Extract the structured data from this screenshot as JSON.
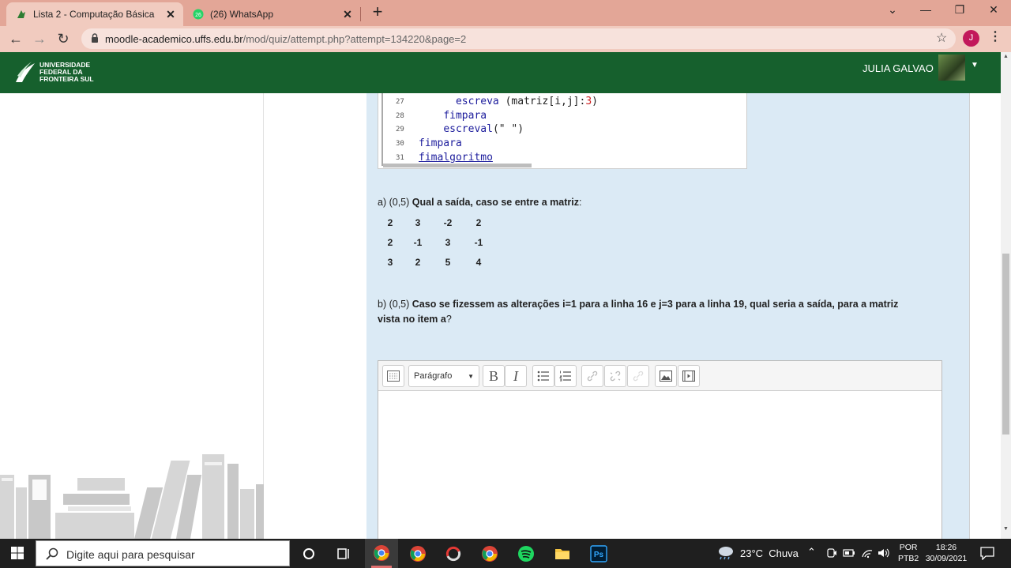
{
  "browser": {
    "tabs": [
      {
        "label": "Lista 2 - Computação Básica",
        "active": true
      },
      {
        "label": "(26) WhatsApp",
        "active": false,
        "badge": "26"
      }
    ],
    "new_tab": "+",
    "close_glyph": "✕",
    "window": {
      "chevron": "⌄",
      "minimize": "—",
      "restore": "❐",
      "close": "✕"
    },
    "url_host": "moodle-academico.uffs.edu.br",
    "url_path": "/mod/quiz/attempt.php?attempt=134220&page=2",
    "profile_initial": "J"
  },
  "moodle": {
    "logo_lines": [
      "UNIVERSIDADE",
      "FEDERAL DA",
      "FRONTEIRA SUL"
    ],
    "user_name": "JULIA GALVAO"
  },
  "code": {
    "lines": [
      {
        "n": "27",
        "indent": "      ",
        "kw": "escreva",
        "rest": " (matriz[i,j]:",
        "num": "3",
        "end": ")"
      },
      {
        "n": "28",
        "indent": "    ",
        "kw": "fimpara",
        "rest": "",
        "num": "",
        "end": ""
      },
      {
        "n": "29",
        "indent": "    ",
        "kw": "escreval",
        "rest": "(\" \")",
        "num": "",
        "end": ""
      },
      {
        "n": "30",
        "indent": "",
        "kw": "fimpara",
        "rest": "",
        "num": "",
        "end": ""
      },
      {
        "n": "31",
        "indent": "",
        "kw": "fimalgoritmo",
        "rest": "",
        "num": "",
        "end": ""
      }
    ]
  },
  "question": {
    "a_prefix": "a) (0,5) ",
    "a_bold": "Qual a saída, caso se entre a matriz",
    "a_suffix": ":",
    "matrix": [
      [
        "2",
        "3",
        "-2",
        "2"
      ],
      [
        "2",
        "-1",
        "3",
        "-1"
      ],
      [
        "3",
        "2",
        "5",
        "4"
      ]
    ],
    "b_prefix": "b) (0,5) ",
    "b_bold_1": "Caso se fizessem as alterações i=1 para a linha 16 e j=3 para a linha 19, qual seria a saída, para a matriz",
    "b_bold_2": "vista no item a",
    "b_suffix": "?"
  },
  "editor": {
    "paragraph_label": "Parágrafo",
    "bold": "B",
    "italic": "I"
  },
  "taskbar": {
    "search_placeholder": "Digite aqui para pesquisar",
    "weather": "23°C  Chuva",
    "lang_1": "POR",
    "lang_2": "PTB2",
    "time": "18:26",
    "date": "30/09/2021"
  },
  "colors": {
    "tabstrip": "#e3a697",
    "header_green": "#16602d",
    "panel_blue": "#dbeaf5",
    "taskbar": "#1f1f1f"
  }
}
